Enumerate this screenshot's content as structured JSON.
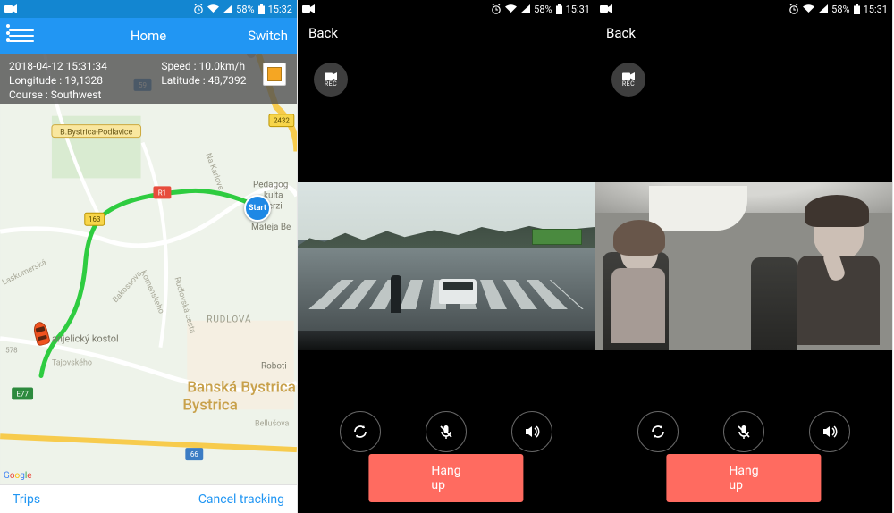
{
  "statusbar": {
    "battery": "58%",
    "time1": "15:32",
    "time2": "15:31",
    "time3": "15:31"
  },
  "phone1": {
    "header": {
      "title": "Home",
      "switch": "Switch"
    },
    "info": {
      "datetime": "2018-04-12 15:31:34",
      "speed_label": "Speed :",
      "speed": "10.0km/h",
      "lon_label": "Longitude :",
      "lon": "19,1328",
      "lat_label": "Latitude :",
      "lat": "48,7392",
      "course_label": "Course :",
      "course": "Southwest"
    },
    "map": {
      "start": "Start",
      "city": "Banská Bystrica",
      "district": "RUDLOVÁ",
      "poi_church": "anjelický kostol",
      "poi_school1": "Pedagog",
      "poi_school2": "kulta",
      "poi_school3": "verzi",
      "poi_school4": "Mateja Be",
      "poi_bb": "B.Bystrica-Podlavice",
      "poi_robot": "Roboti",
      "poi_kar": "Na Karlove",
      "poi_lasko": "Laskomerská",
      "poi_komen": "Komenskeho",
      "poi_bako": "Bakossova",
      "poi_rud": "Rudlovská cesta",
      "poi_taj": "Tajovského",
      "poi_bel": "Bellušova",
      "road163": "163",
      "roadR1": "R1",
      "roadE77": "E77",
      "road59": "59",
      "road66": "66",
      "road2432": "2432",
      "elev": "578",
      "google": "Google"
    },
    "bottom": {
      "trips": "Trips",
      "cancel": "Cancel tracking"
    }
  },
  "phone2": {
    "back": "Back",
    "rec": "REC",
    "hangup": "Hang up"
  },
  "phone3": {
    "back": "Back",
    "rec": "REC",
    "hangup": "Hang up"
  }
}
